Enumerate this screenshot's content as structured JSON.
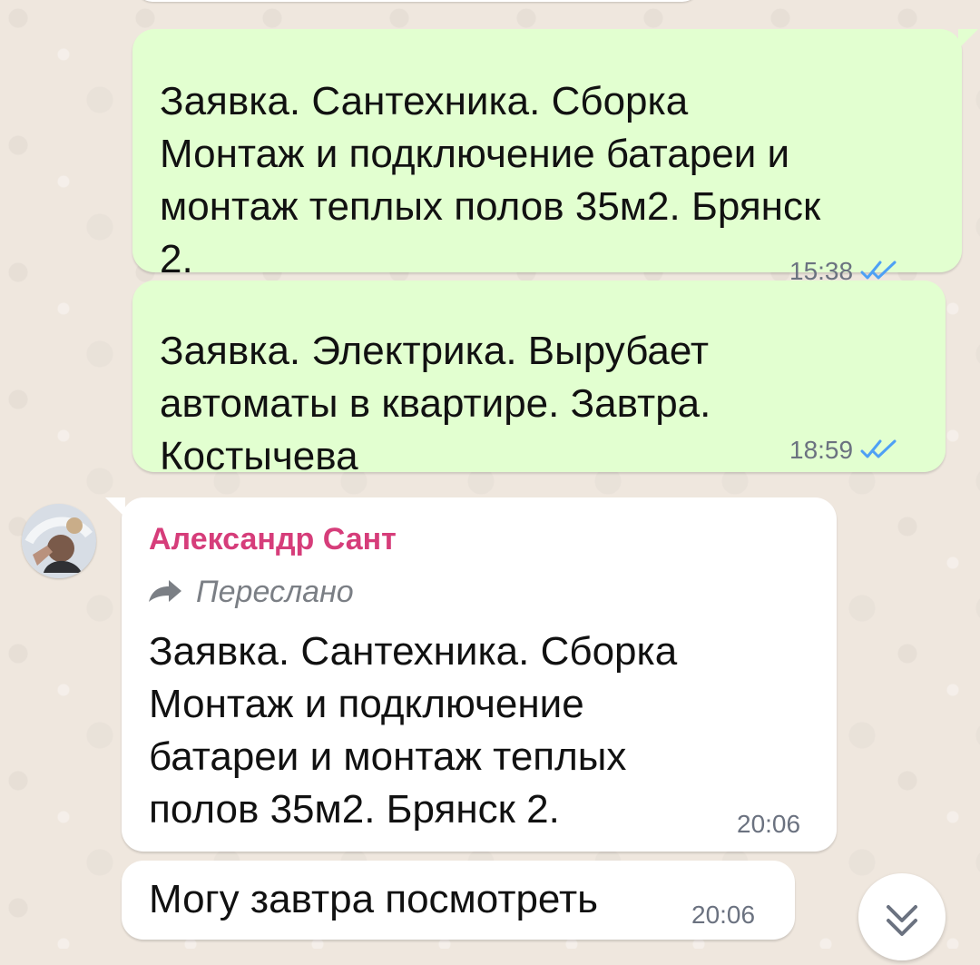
{
  "messages": [
    {
      "lines": [
        "Заявка. Сантехника. Сборка",
        "Монтаж и подключение батареи и",
        "монтаж теплых полов 35м2. Брянск",
        "2."
      ],
      "time": "15:38",
      "status_icon": "double-check-icon",
      "status_color": "#4ea0f5"
    },
    {
      "lines": [
        "Заявка. Электрика.  Вырубает",
        "автоматы в квартире. Завтра.",
        "Костычева"
      ],
      "time": "18:59",
      "status_icon": "double-check-icon",
      "status_color": "#4ea0f5"
    },
    {
      "sender": "Александр Сант",
      "forwarded_label": "Переслано",
      "lines": [
        "Заявка. Сантехника. Сборка",
        "Монтаж и подключение",
        "батареи и монтаж теплых",
        "полов 35м2. Брянск 2."
      ],
      "time": "20:06"
    },
    {
      "lines": [
        "Могу завтра посмотреть"
      ],
      "time": "20:06"
    }
  ],
  "colors": {
    "wallpaper": "#efe7de",
    "outgoing_bubble": "#e2ffd0",
    "incoming_bubble": "#ffffff",
    "sender_name": "#d63d7a",
    "timestamp": "#6b7280"
  },
  "icons": {
    "avatar": "avatar",
    "forward": "forward-arrow-icon",
    "scroll_down": "chevron-double-down-icon"
  }
}
